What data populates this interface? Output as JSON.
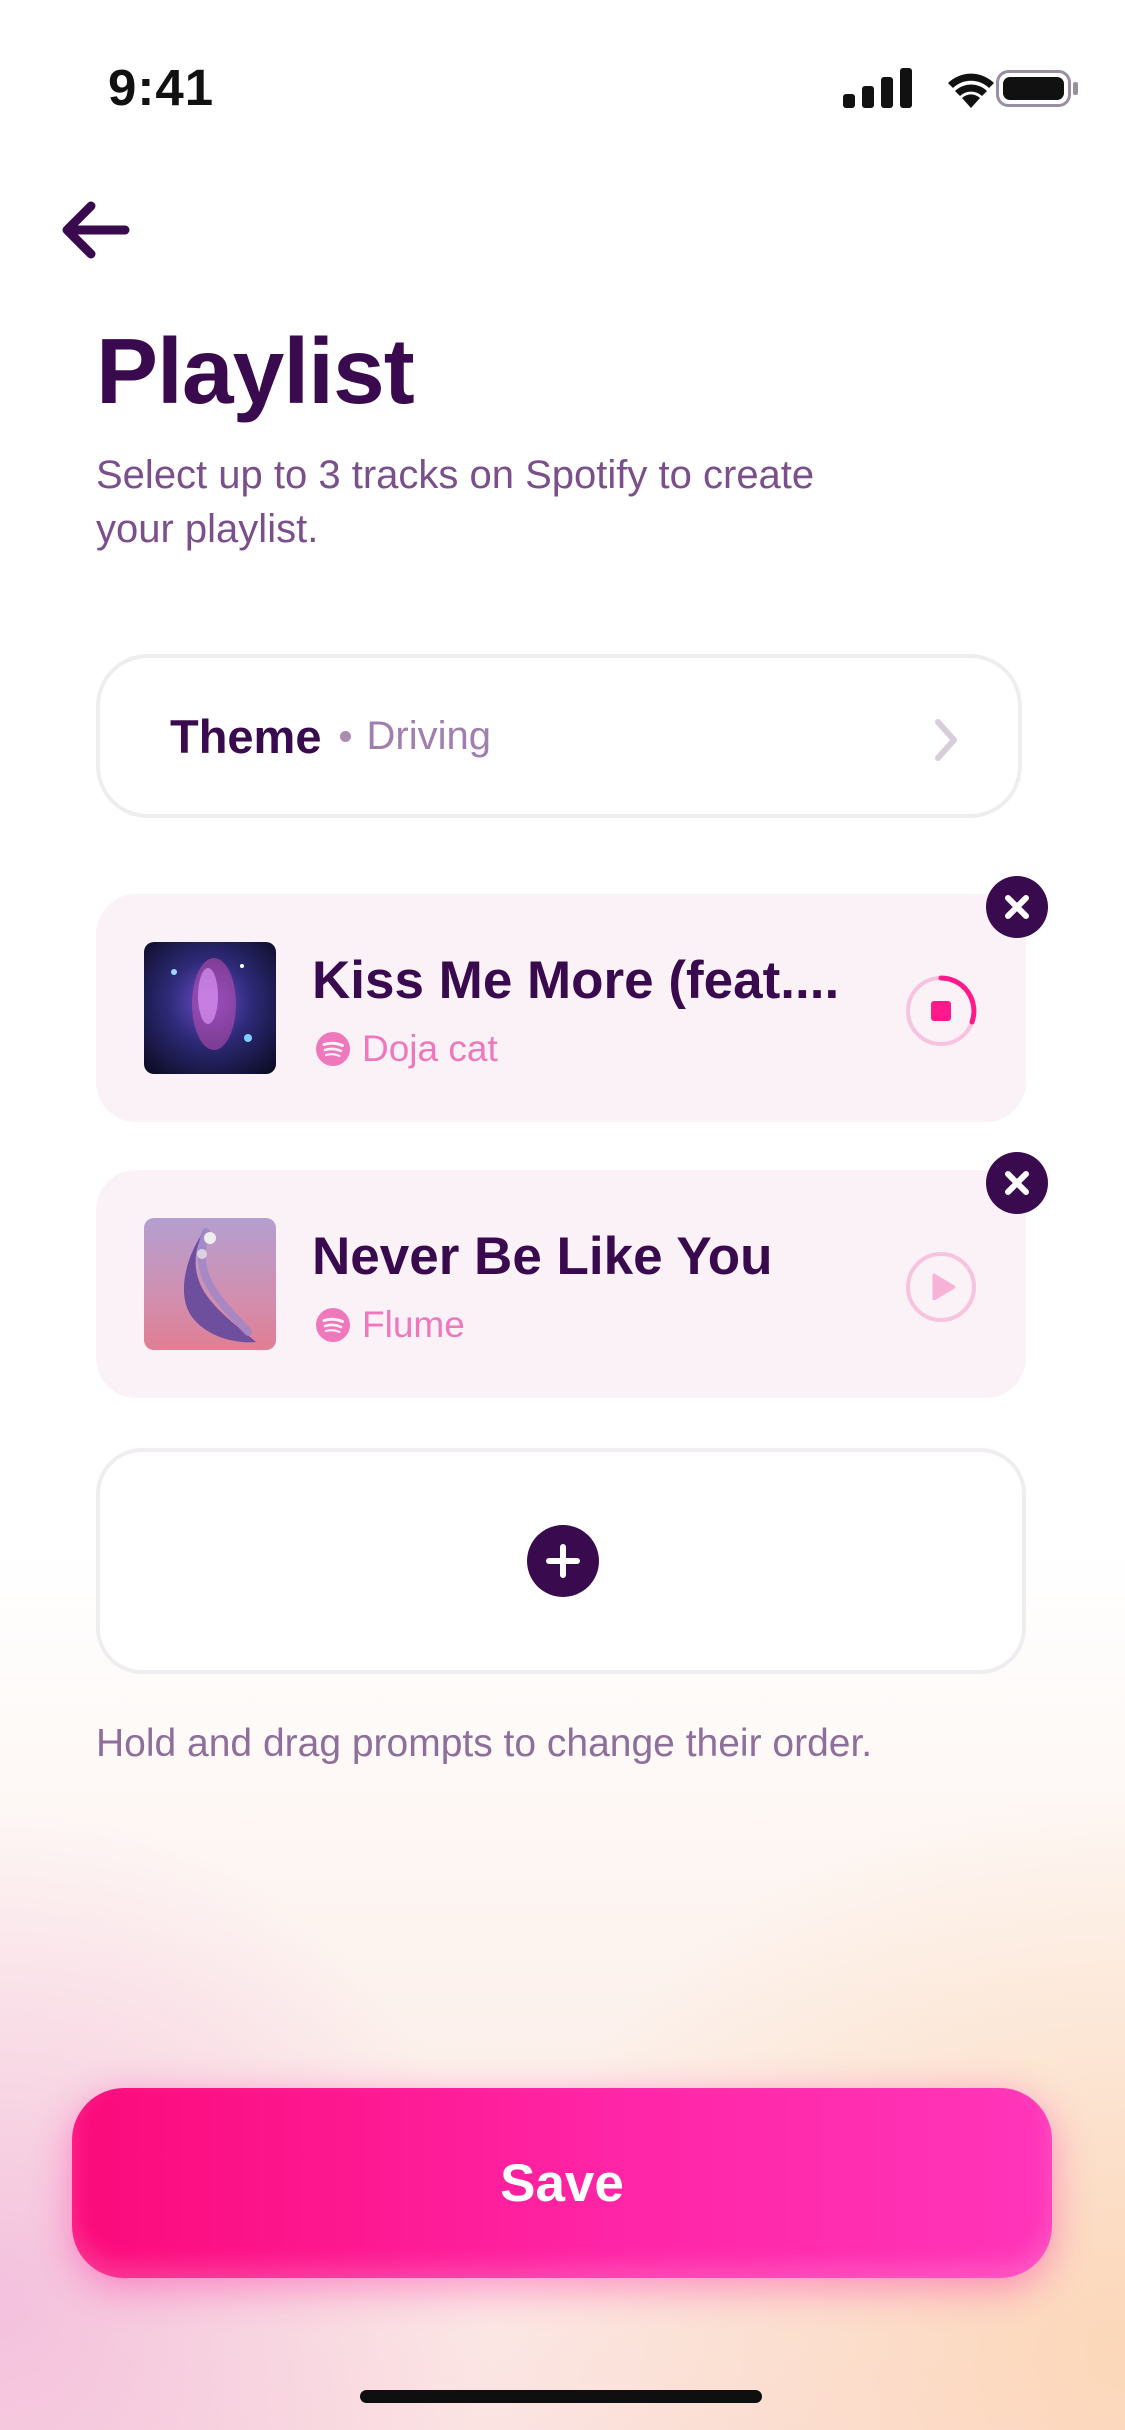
{
  "status_bar": {
    "time": "9:41"
  },
  "header": {
    "back_icon": "arrow-left-icon",
    "title": "Playlist",
    "subtitle": "Select up to 3 tracks on Spotify to create your playlist."
  },
  "theme": {
    "label": "Theme",
    "value": "Driving",
    "chevron_icon": "chevron-right-icon"
  },
  "tracks": [
    {
      "title": "Kiss Me More (feat....",
      "artist": "Doja cat",
      "state": "playing",
      "control_icon": "stop-icon"
    },
    {
      "title": "Never Be Like You",
      "artist": "Flume",
      "state": "paused",
      "control_icon": "play-icon"
    }
  ],
  "add_track": {
    "icon": "plus-icon"
  },
  "hint": "Hold and drag prompts to change their order.",
  "save_label": "Save",
  "colors": {
    "primary_dark": "#3a0a4f",
    "accent_pink": "#ff1a8c",
    "artist_pink": "#ee78bb",
    "card_bg": "#fbf2f8"
  }
}
